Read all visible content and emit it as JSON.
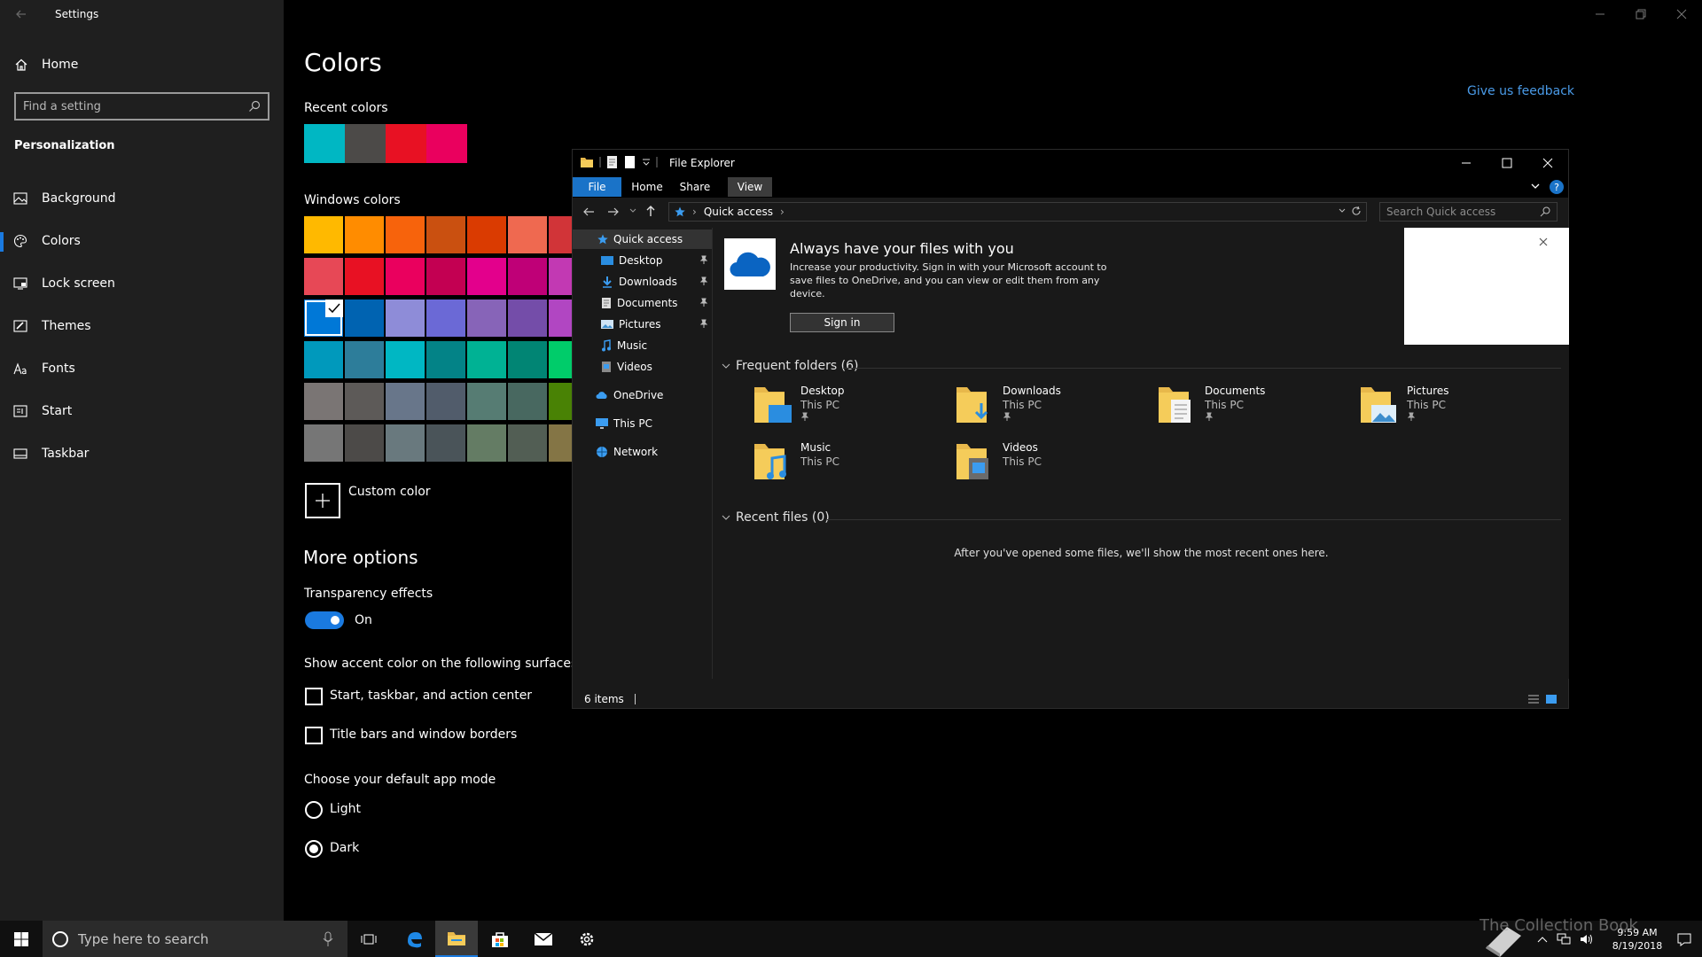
{
  "settings": {
    "window_title": "Settings",
    "home_label": "Home",
    "search_placeholder": "Find a setting",
    "section": "Personalization",
    "nav": [
      {
        "label": "Background",
        "icon": "picture-icon"
      },
      {
        "label": "Colors",
        "icon": "palette-icon"
      },
      {
        "label": "Lock screen",
        "icon": "lock-screen-icon"
      },
      {
        "label": "Themes",
        "icon": "brush-icon"
      },
      {
        "label": "Fonts",
        "icon": "font-icon"
      },
      {
        "label": "Start",
        "icon": "start-menu-icon"
      },
      {
        "label": "Taskbar",
        "icon": "taskbar-icon"
      }
    ],
    "active_nav": "Colors",
    "feedback": "Give us feedback"
  },
  "colors_page": {
    "title": "Colors",
    "recent_label": "Recent colors",
    "recent_colors": [
      "#00b7c3",
      "#4c4a48",
      "#e81123",
      "#ea005e"
    ],
    "windows_label": "Windows colors",
    "windows_colors": [
      [
        "#ffb900",
        "#ff8c00",
        "#f7630c",
        "#ca5010",
        "#da3b01",
        "#ef6950",
        "#d13438"
      ],
      [
        "#e74856",
        "#e81123",
        "#ea005e",
        "#c30052",
        "#e3008c",
        "#bf0077",
        "#c239b3"
      ],
      [
        "#0078d7",
        "#0063b1",
        "#8e8cd8",
        "#6b69d6",
        "#8764b8",
        "#744da9",
        "#b146c2"
      ],
      [
        "#0099bc",
        "#2d7d9a",
        "#00b7c3",
        "#038387",
        "#00b294",
        "#018574",
        "#00cc6a"
      ],
      [
        "#7a7574",
        "#5d5a58",
        "#68768a",
        "#515c6b",
        "#567c73",
        "#486860",
        "#498205"
      ],
      [
        "#767676",
        "#4c4a48",
        "#69797e",
        "#4a5459",
        "#647c64",
        "#525e54",
        "#847545"
      ]
    ],
    "selected_color": "#0078d7",
    "custom_label": "Custom color",
    "more_options": "More options",
    "transparency_label": "Transparency effects",
    "transparency_state": "On",
    "accent_surfaces_label": "Show accent color on the following surfaces",
    "checkbox_start": "Start, taskbar, and action center",
    "checkbox_titlebars": "Title bars and window borders",
    "app_mode_label": "Choose your default app mode",
    "mode_light": "Light",
    "mode_dark": "Dark",
    "selected_mode": "Dark"
  },
  "explorer": {
    "title": "File Explorer",
    "ribbon_tabs": [
      "File",
      "Home",
      "Share",
      "View"
    ],
    "address": "Quick access",
    "search_placeholder": "Search Quick access",
    "nav_items": [
      {
        "label": "Quick access",
        "icon": "star-icon"
      },
      {
        "label": "Desktop",
        "icon": "desktop-icon",
        "pinned": true
      },
      {
        "label": "Downloads",
        "icon": "download-icon",
        "pinned": true
      },
      {
        "label": "Documents",
        "icon": "documents-icon",
        "pinned": true
      },
      {
        "label": "Pictures",
        "icon": "pictures-icon",
        "pinned": true
      },
      {
        "label": "Music",
        "icon": "music-icon"
      },
      {
        "label": "Videos",
        "icon": "videos-icon"
      },
      {
        "label": "OneDrive",
        "icon": "cloud-icon"
      },
      {
        "label": "This PC",
        "icon": "computer-icon"
      },
      {
        "label": "Network",
        "icon": "network-icon"
      }
    ],
    "onedrive_title": "Always have your files with you",
    "onedrive_desc": "Increase your productivity. Sign in with your Microsoft account to save files to OneDrive, and you can view or edit them from any device.",
    "signin": "Sign in",
    "frequent_header": "Frequent folders (6)",
    "folders": [
      {
        "name": "Desktop",
        "location": "This PC",
        "pinned": true
      },
      {
        "name": "Downloads",
        "location": "This PC",
        "pinned": true
      },
      {
        "name": "Documents",
        "location": "This PC",
        "pinned": true
      },
      {
        "name": "Pictures",
        "location": "This PC",
        "pinned": true
      },
      {
        "name": "Music",
        "location": "This PC",
        "pinned": false
      },
      {
        "name": "Videos",
        "location": "This PC",
        "pinned": false
      }
    ],
    "recent_header": "Recent files (0)",
    "recent_empty": "After you've opened some files, we'll show the most recent ones here.",
    "status": "6 items"
  },
  "taskbar": {
    "search_placeholder": "Type here to search",
    "time": "9:59 AM",
    "date": "8/19/2018"
  },
  "watermark": "The Collection Book",
  "accent": "#1a7ae0"
}
